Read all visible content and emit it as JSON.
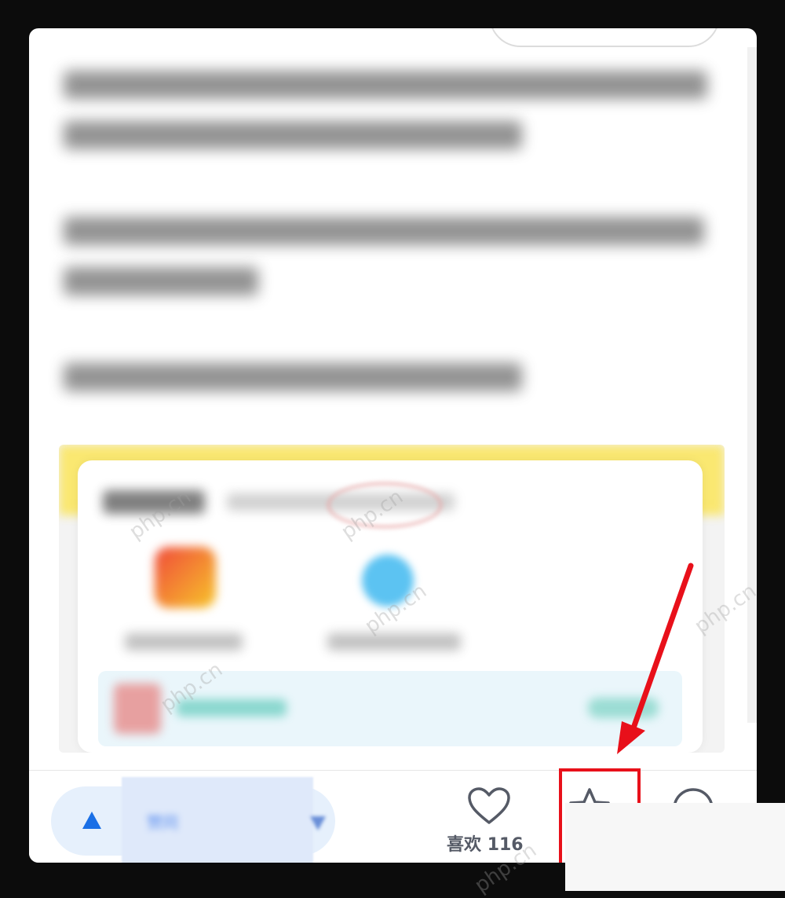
{
  "article": {
    "blurred_paragraph_lines": 5
  },
  "embed": {
    "watermark": "php.cn"
  },
  "bottom_bar": {
    "like_label": "喜欢",
    "like_count": "116",
    "vote_label": "赞同"
  },
  "watermarks": [
    "php.cn",
    "php.cn",
    "php.cn",
    "php.cn",
    "php.cn",
    "php.cn"
  ],
  "colors": {
    "accent_blue": "#1a6fe6",
    "highlight_red": "#e8101a"
  },
  "icons": [
    "heart-icon",
    "star-icon",
    "comment-icon",
    "upvote-icon",
    "downvote-icon"
  ]
}
